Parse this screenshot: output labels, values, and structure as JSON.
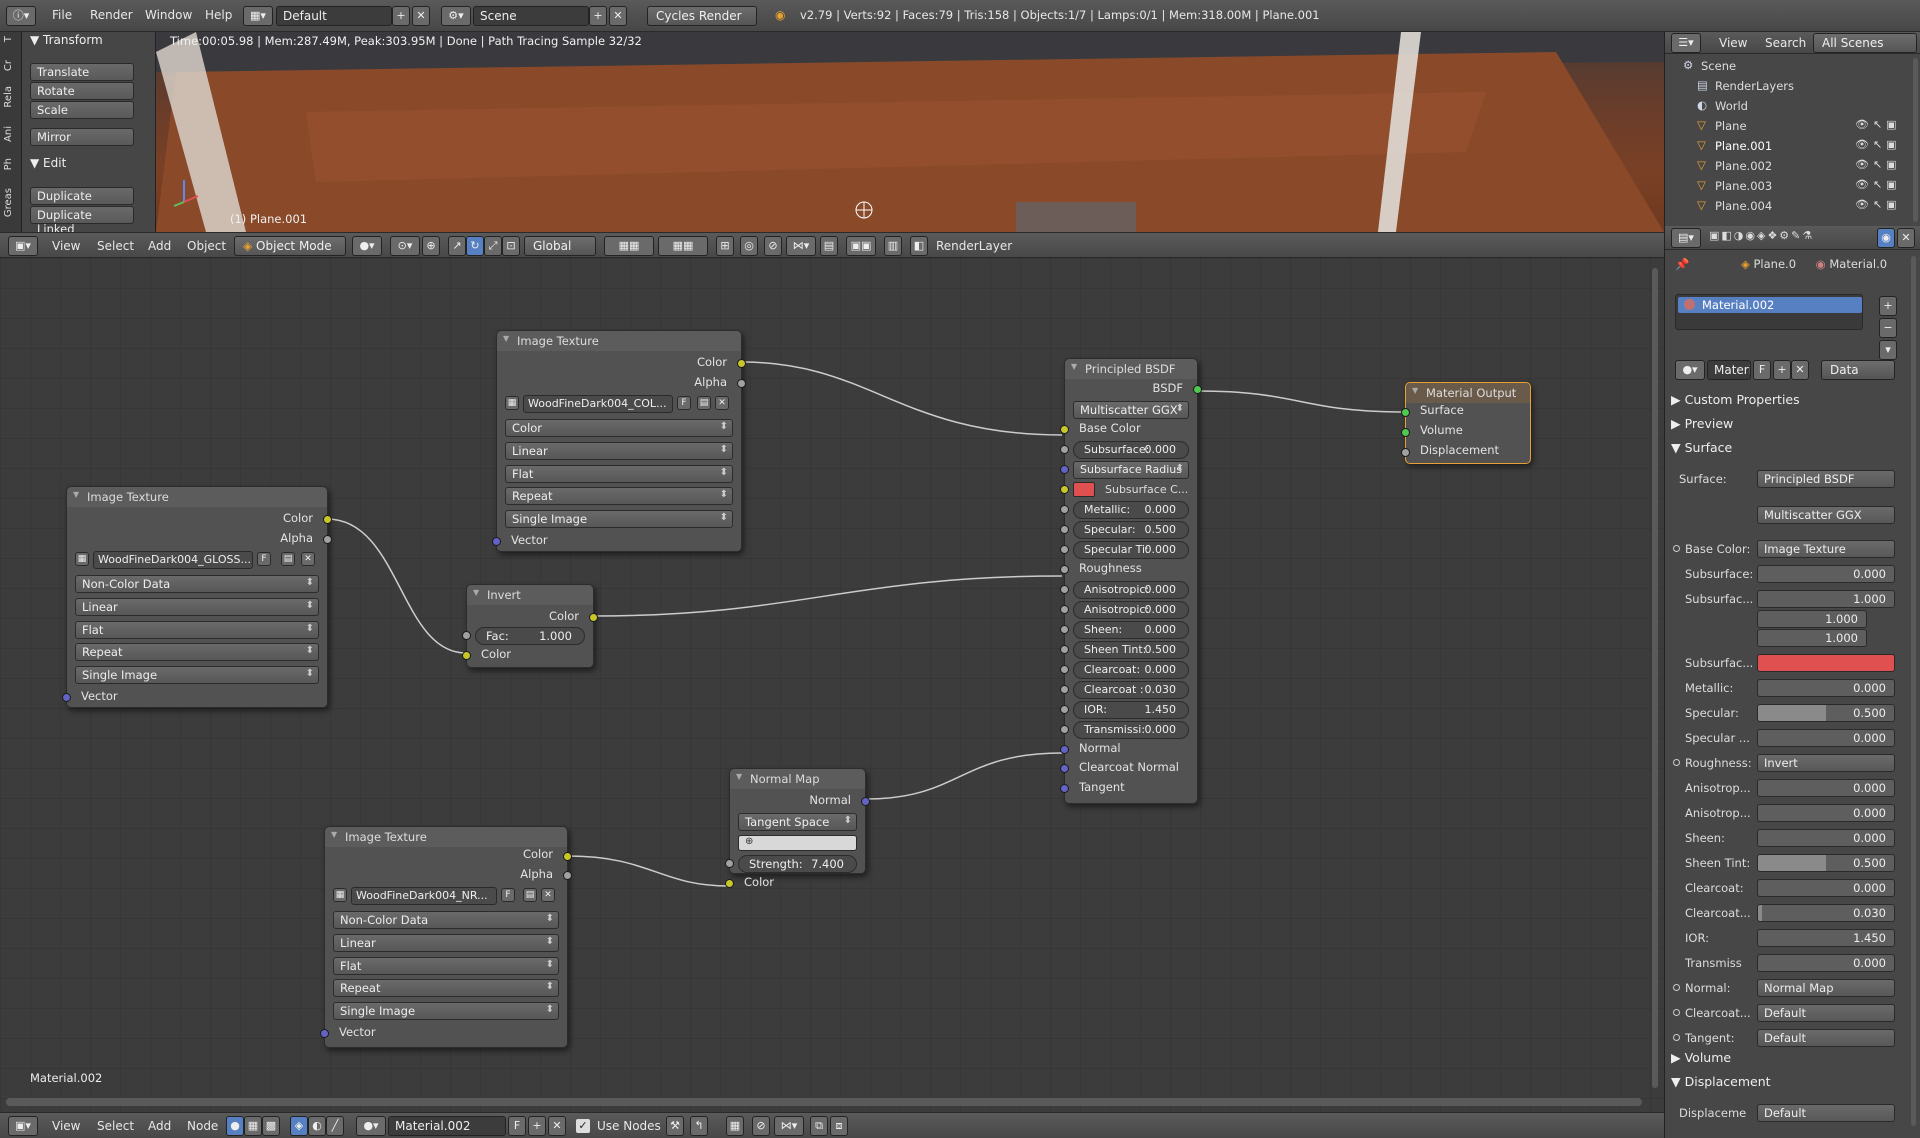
{
  "topbar": {
    "menus": [
      "File",
      "Render",
      "Window",
      "Help"
    ],
    "layout": "Default",
    "scene": "Scene",
    "engine": "Cycles Render",
    "stats": "v2.79 | Verts:92 | Faces:79 | Tris:158 | Objects:1/7 | Lamps:0/1 | Mem:318.00M | Plane.001"
  },
  "toolshelf": {
    "transform_title": "Transform",
    "transform_buttons": [
      "Translate",
      "Rotate",
      "Scale"
    ],
    "mirror": "Mirror",
    "edit_title": "Edit",
    "edit_buttons": [
      "Duplicate",
      "Duplicate Linked"
    ],
    "tabs": [
      "T",
      "Cr",
      "Rela",
      "Ani",
      "Ph",
      "Greas"
    ]
  },
  "viewport": {
    "status": "Time:00:05.98 | Mem:287.49M, Peak:303.95M | Done | Path Tracing Sample 32/32",
    "object_label": "(1) Plane.001"
  },
  "vp_header": {
    "menus": [
      "View",
      "Select",
      "Add",
      "Object"
    ],
    "mode": "Object Mode",
    "orientation": "Global",
    "renderlayer": "RenderLayer"
  },
  "nodes": {
    "tex_color": {
      "title": "Image Texture",
      "out1": "Color",
      "out2": "Alpha",
      "image": "WoodFineDark004_COL...",
      "f": "F",
      "opts": [
        "Color",
        "Linear",
        "Flat",
        "Repeat",
        "Single Image"
      ],
      "in1": "Vector"
    },
    "tex_gloss": {
      "title": "Image Texture",
      "out1": "Color",
      "out2": "Alpha",
      "image": "WoodFineDark004_GLOSS...",
      "f": "F",
      "opts": [
        "Non-Color Data",
        "Linear",
        "Flat",
        "Repeat",
        "Single Image"
      ],
      "in1": "Vector"
    },
    "tex_nrm": {
      "title": "Image Texture",
      "out1": "Color",
      "out2": "Alpha",
      "image": "WoodFineDark004_NR...",
      "f": "F",
      "opts": [
        "Non-Color Data",
        "Linear",
        "Flat",
        "Repeat",
        "Single Image"
      ],
      "in1": "Vector"
    },
    "invert": {
      "title": "Invert",
      "out1": "Color",
      "fac_label": "Fac:",
      "fac": "1.000",
      "in1": "Color"
    },
    "normalmap": {
      "title": "Normal Map",
      "out1": "Normal",
      "space": "Tangent Space",
      "strength_label": "Strength:",
      "strength": "7.400",
      "in1": "Color"
    },
    "bsdf": {
      "title": "Principled BSDF",
      "out1": "BSDF",
      "dist": "Multiscatter GGX",
      "base_color": "Base Color",
      "fields": [
        {
          "label": "Subsurface:",
          "value": "0.000"
        },
        {
          "label": "Subsurface Radius",
          "value": ""
        },
        {
          "label": "Subsurface C...",
          "value": ""
        },
        {
          "label": "Metallic:",
          "value": "0.000"
        },
        {
          "label": "Specular:",
          "value": "0.500"
        },
        {
          "label": "Specular Ti:",
          "value": "0.000"
        },
        {
          "label": "Roughness",
          "value": ""
        },
        {
          "label": "Anisotropic:",
          "value": "0.000"
        },
        {
          "label": "Anisotropic:",
          "value": "0.000"
        },
        {
          "label": "Sheen:",
          "value": "0.000"
        },
        {
          "label": "Sheen Tint:",
          "value": "0.500"
        },
        {
          "label": "Clearcoat:",
          "value": "0.000"
        },
        {
          "label": "Clearcoat :",
          "value": "0.030"
        },
        {
          "label": "IOR:",
          "value": "1.450"
        },
        {
          "label": "Transmissi:",
          "value": "0.000"
        },
        {
          "label": "Normal",
          "value": ""
        },
        {
          "label": "Clearcoat Normal",
          "value": ""
        },
        {
          "label": "Tangent",
          "value": ""
        }
      ]
    },
    "output": {
      "title": "Material Output",
      "in1": "Surface",
      "in2": "Volume",
      "in3": "Displacement"
    }
  },
  "node_editor": {
    "material_label": "Material.002"
  },
  "ne_footer": {
    "menus": [
      "View",
      "Select",
      "Add",
      "Node"
    ],
    "material": "Material.002",
    "f": "F",
    "use_nodes": "Use Nodes"
  },
  "outliner": {
    "menus": [
      "View",
      "Search"
    ],
    "filter": "All Scenes",
    "items": [
      "Scene",
      "RenderLayers",
      "World",
      "Plane",
      "Plane.001",
      "Plane.002",
      "Plane.003",
      "Plane.004"
    ]
  },
  "props": {
    "breadcrumb": [
      "Plane.0",
      "Material.0"
    ],
    "slot": "Material.002",
    "mat_name": "Materi",
    "f": "F",
    "data": "Data",
    "sections": [
      "Custom Properties",
      "Preview",
      "Surface"
    ],
    "surface_label": "Surface:",
    "surface_value": "Principled BSDF",
    "dist": "Multiscatter GGX",
    "rows": [
      {
        "label": "Base Color:",
        "value": "Image Texture",
        "kind": "menu"
      },
      {
        "label": "Subsurface:",
        "value": "0.000",
        "kind": "num",
        "fill": 0
      },
      {
        "label": "Subsurfac...",
        "value": "1.000",
        "kind": "num",
        "fill": 0
      },
      {
        "label": "",
        "value": "1.000",
        "kind": "num",
        "fill": 0
      },
      {
        "label": "",
        "value": "1.000",
        "kind": "num",
        "fill": 0
      },
      {
        "label": "Subsurfac...",
        "value": "",
        "kind": "color",
        "color": "#e05050"
      },
      {
        "label": "Metallic:",
        "value": "0.000",
        "kind": "num",
        "fill": 0
      },
      {
        "label": "Specular:",
        "value": "0.500",
        "kind": "num",
        "fill": 0.5
      },
      {
        "label": "Specular ...",
        "value": "0.000",
        "kind": "num",
        "fill": 0
      },
      {
        "label": "Roughness:",
        "value": "Invert",
        "kind": "menu"
      },
      {
        "label": "Anisotrop...",
        "value": "0.000",
        "kind": "num",
        "fill": 0
      },
      {
        "label": "Anisotrop...",
        "value": "0.000",
        "kind": "num",
        "fill": 0
      },
      {
        "label": "Sheen:",
        "value": "0.000",
        "kind": "num",
        "fill": 0
      },
      {
        "label": "Sheen Tint:",
        "value": "0.500",
        "kind": "num",
        "fill": 0.5
      },
      {
        "label": "Clearcoat:",
        "value": "0.000",
        "kind": "num",
        "fill": 0
      },
      {
        "label": "Clearcoat...",
        "value": "0.030",
        "kind": "num",
        "fill": 0.03
      },
      {
        "label": "IOR:",
        "value": "1.450",
        "kind": "num",
        "fill": 0
      },
      {
        "label": "Transmiss",
        "value": "0.000",
        "kind": "num",
        "fill": 0
      },
      {
        "label": "Normal:",
        "value": "Normal Map",
        "kind": "menu"
      },
      {
        "label": "Clearcoat...",
        "value": "Default",
        "kind": "menu"
      },
      {
        "label": "Tangent:",
        "value": "Default",
        "kind": "menu"
      }
    ],
    "volume": "Volume",
    "displacement": "Displacement",
    "disp_label": "Displaceme",
    "disp_value": "Default"
  },
  "colors": {
    "accent_select": "#5680c2",
    "node_select": "#e8a030",
    "socket_yellow": "#c7c729",
    "socket_blue": "#6363c7",
    "socket_green": "#4fc94f",
    "subsurface_color": "#e05050"
  }
}
